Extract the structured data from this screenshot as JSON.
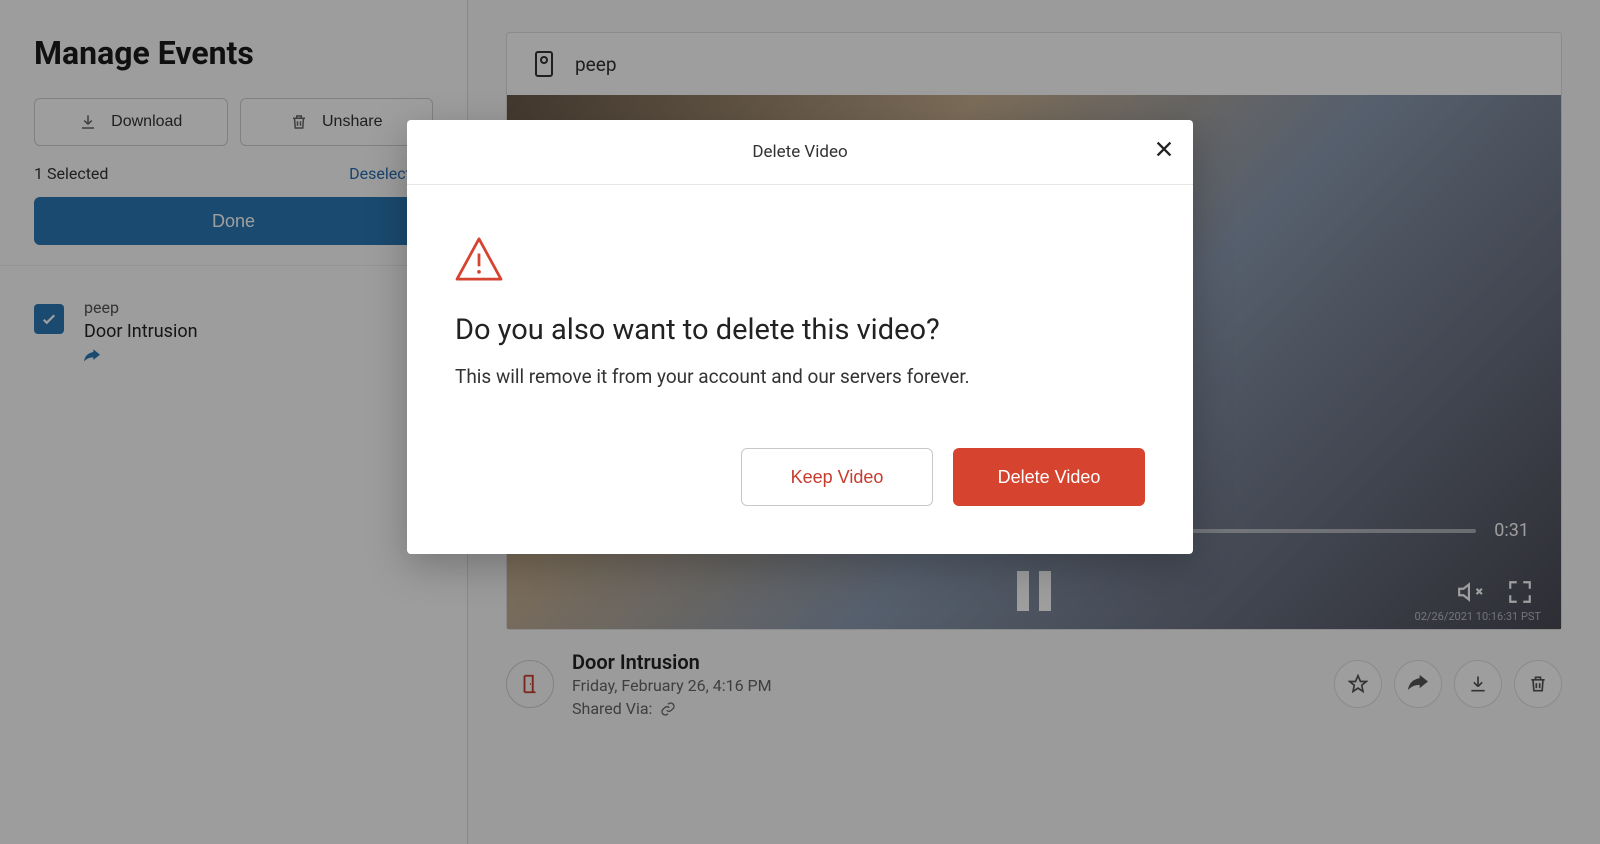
{
  "sidebar": {
    "title": "Manage Events",
    "download_label": "Download",
    "unshare_label": "Unshare",
    "selected_text": "1 Selected",
    "deselect_text": "Deselect All",
    "done_label": "Done"
  },
  "event": {
    "camera": "peep",
    "title": "Door Intrusion"
  },
  "player": {
    "camera_name": "peep",
    "duration": "0:31",
    "timestamp": "02/26/2021 10:16:31 PST"
  },
  "meta": {
    "title": "Door Intrusion",
    "datetime": "Friday, February 26, 4:16 PM",
    "shared_label": "Shared Via:"
  },
  "modal": {
    "title": "Delete Video",
    "question": "Do you also want to delete this video?",
    "description": "This will remove it from your account and our servers forever.",
    "keep_label": "Keep Video",
    "delete_label": "Delete Video"
  }
}
